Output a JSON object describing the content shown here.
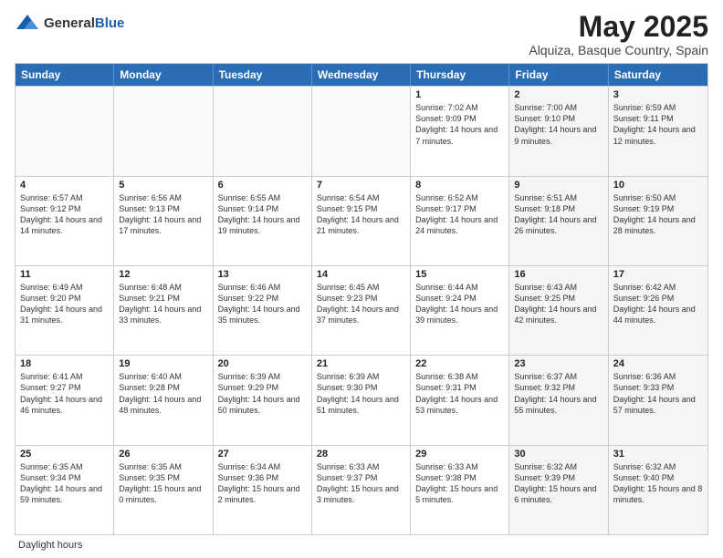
{
  "header": {
    "logo_general": "General",
    "logo_blue": "Blue",
    "month_year": "May 2025",
    "location": "Alquiza, Basque Country, Spain"
  },
  "days_of_week": [
    "Sunday",
    "Monday",
    "Tuesday",
    "Wednesday",
    "Thursday",
    "Friday",
    "Saturday"
  ],
  "footer": {
    "label": "Daylight hours"
  },
  "weeks": [
    [
      {
        "day": "",
        "info": ""
      },
      {
        "day": "",
        "info": ""
      },
      {
        "day": "",
        "info": ""
      },
      {
        "day": "",
        "info": ""
      },
      {
        "day": "1",
        "info": "Sunrise: 7:02 AM\nSunset: 9:09 PM\nDaylight: 14 hours\nand 7 minutes."
      },
      {
        "day": "2",
        "info": "Sunrise: 7:00 AM\nSunset: 9:10 PM\nDaylight: 14 hours\nand 9 minutes."
      },
      {
        "day": "3",
        "info": "Sunrise: 6:59 AM\nSunset: 9:11 PM\nDaylight: 14 hours\nand 12 minutes."
      }
    ],
    [
      {
        "day": "4",
        "info": "Sunrise: 6:57 AM\nSunset: 9:12 PM\nDaylight: 14 hours\nand 14 minutes."
      },
      {
        "day": "5",
        "info": "Sunrise: 6:56 AM\nSunset: 9:13 PM\nDaylight: 14 hours\nand 17 minutes."
      },
      {
        "day": "6",
        "info": "Sunrise: 6:55 AM\nSunset: 9:14 PM\nDaylight: 14 hours\nand 19 minutes."
      },
      {
        "day": "7",
        "info": "Sunrise: 6:54 AM\nSunset: 9:15 PM\nDaylight: 14 hours\nand 21 minutes."
      },
      {
        "day": "8",
        "info": "Sunrise: 6:52 AM\nSunset: 9:17 PM\nDaylight: 14 hours\nand 24 minutes."
      },
      {
        "day": "9",
        "info": "Sunrise: 6:51 AM\nSunset: 9:18 PM\nDaylight: 14 hours\nand 26 minutes."
      },
      {
        "day": "10",
        "info": "Sunrise: 6:50 AM\nSunset: 9:19 PM\nDaylight: 14 hours\nand 28 minutes."
      }
    ],
    [
      {
        "day": "11",
        "info": "Sunrise: 6:49 AM\nSunset: 9:20 PM\nDaylight: 14 hours\nand 31 minutes."
      },
      {
        "day": "12",
        "info": "Sunrise: 6:48 AM\nSunset: 9:21 PM\nDaylight: 14 hours\nand 33 minutes."
      },
      {
        "day": "13",
        "info": "Sunrise: 6:46 AM\nSunset: 9:22 PM\nDaylight: 14 hours\nand 35 minutes."
      },
      {
        "day": "14",
        "info": "Sunrise: 6:45 AM\nSunset: 9:23 PM\nDaylight: 14 hours\nand 37 minutes."
      },
      {
        "day": "15",
        "info": "Sunrise: 6:44 AM\nSunset: 9:24 PM\nDaylight: 14 hours\nand 39 minutes."
      },
      {
        "day": "16",
        "info": "Sunrise: 6:43 AM\nSunset: 9:25 PM\nDaylight: 14 hours\nand 42 minutes."
      },
      {
        "day": "17",
        "info": "Sunrise: 6:42 AM\nSunset: 9:26 PM\nDaylight: 14 hours\nand 44 minutes."
      }
    ],
    [
      {
        "day": "18",
        "info": "Sunrise: 6:41 AM\nSunset: 9:27 PM\nDaylight: 14 hours\nand 46 minutes."
      },
      {
        "day": "19",
        "info": "Sunrise: 6:40 AM\nSunset: 9:28 PM\nDaylight: 14 hours\nand 48 minutes."
      },
      {
        "day": "20",
        "info": "Sunrise: 6:39 AM\nSunset: 9:29 PM\nDaylight: 14 hours\nand 50 minutes."
      },
      {
        "day": "21",
        "info": "Sunrise: 6:39 AM\nSunset: 9:30 PM\nDaylight: 14 hours\nand 51 minutes."
      },
      {
        "day": "22",
        "info": "Sunrise: 6:38 AM\nSunset: 9:31 PM\nDaylight: 14 hours\nand 53 minutes."
      },
      {
        "day": "23",
        "info": "Sunrise: 6:37 AM\nSunset: 9:32 PM\nDaylight: 14 hours\nand 55 minutes."
      },
      {
        "day": "24",
        "info": "Sunrise: 6:36 AM\nSunset: 9:33 PM\nDaylight: 14 hours\nand 57 minutes."
      }
    ],
    [
      {
        "day": "25",
        "info": "Sunrise: 6:35 AM\nSunset: 9:34 PM\nDaylight: 14 hours\nand 59 minutes."
      },
      {
        "day": "26",
        "info": "Sunrise: 6:35 AM\nSunset: 9:35 PM\nDaylight: 15 hours\nand 0 minutes."
      },
      {
        "day": "27",
        "info": "Sunrise: 6:34 AM\nSunset: 9:36 PM\nDaylight: 15 hours\nand 2 minutes."
      },
      {
        "day": "28",
        "info": "Sunrise: 6:33 AM\nSunset: 9:37 PM\nDaylight: 15 hours\nand 3 minutes."
      },
      {
        "day": "29",
        "info": "Sunrise: 6:33 AM\nSunset: 9:38 PM\nDaylight: 15 hours\nand 5 minutes."
      },
      {
        "day": "30",
        "info": "Sunrise: 6:32 AM\nSunset: 9:39 PM\nDaylight: 15 hours\nand 6 minutes."
      },
      {
        "day": "31",
        "info": "Sunrise: 6:32 AM\nSunset: 9:40 PM\nDaylight: 15 hours\nand 8 minutes."
      }
    ]
  ]
}
